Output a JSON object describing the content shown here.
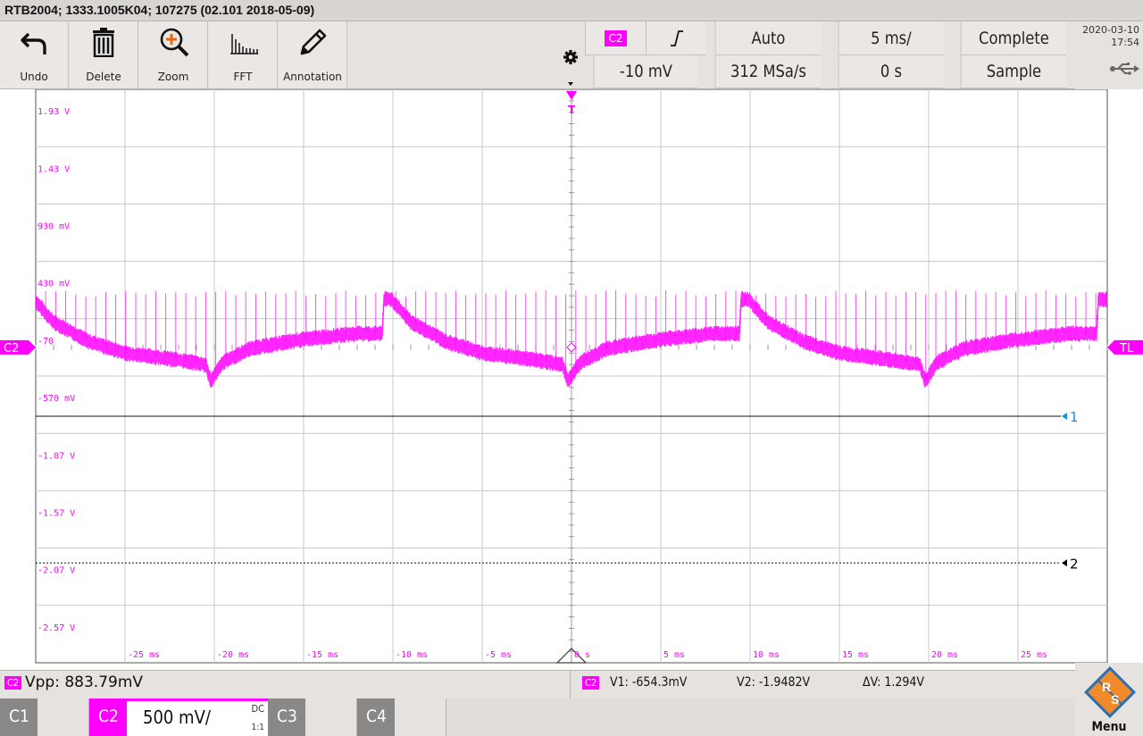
{
  "window": {
    "title": "RTB2004; 1333.1005K04; 107275 (02.101 2018-05-09)"
  },
  "toolbar": {
    "tools": [
      {
        "label": "Undo",
        "icon": "undo-icon"
      },
      {
        "label": "Delete",
        "icon": "trash-icon"
      },
      {
        "label": "Zoom",
        "icon": "zoom-icon"
      },
      {
        "label": "FFT",
        "icon": "fft-icon"
      },
      {
        "label": "Annotation",
        "icon": "pencil-icon"
      }
    ]
  },
  "trigger": {
    "source": "C2",
    "slope_symbol": "╯",
    "mode": "Auto",
    "timebase": "5 ms/",
    "acq_state": "Complete",
    "level": "-10 mV",
    "sample_rate": "312 MSa/s",
    "position": "0 s",
    "acq_mode": "Sample"
  },
  "datetime": {
    "date": "2020-03-10",
    "time": "17:54"
  },
  "chart_data": {
    "type": "line",
    "title": "",
    "xlabel": "",
    "ylabel": "",
    "x_ticks": [
      "-25 ms",
      "-20 ms",
      "-15 ms",
      "-10 ms",
      "-5 ms",
      "0 s",
      "5 ms",
      "10 ms",
      "15 ms",
      "20 ms",
      "25 ms"
    ],
    "x_tick_values_ms": [
      -25,
      -20,
      -15,
      -10,
      -5,
      0,
      5,
      10,
      15,
      20,
      25
    ],
    "y_ticks": [
      "1.93 V",
      "1.43 V",
      "930 mV",
      "430 mV",
      "-70",
      "-570 mV",
      "-1.07 V",
      "-1.57 V",
      "-2.07 V",
      "-2.57 V"
    ],
    "y_tick_values_v": [
      1.93,
      1.43,
      0.93,
      0.43,
      -0.07,
      -0.57,
      -1.07,
      -1.57,
      -2.07,
      -2.57
    ],
    "xlim_ms": [
      -30,
      30
    ],
    "ylim_v": [
      -2.82,
      2.18
    ],
    "grid": true,
    "series": [
      {
        "name": "C2",
        "color": "#ff00ff",
        "period_ms": 20,
        "spike_spacing_ms": 0.56,
        "baseline_v": [
          [
            -30,
            0.33
          ],
          [
            -29,
            0.15
          ],
          [
            -27,
            -0.02
          ],
          [
            -25,
            -0.12
          ],
          [
            -22,
            -0.18
          ],
          [
            -20.5,
            -0.22
          ],
          [
            -20.2,
            -0.36
          ],
          [
            -19.5,
            -0.2
          ],
          [
            -18,
            -0.08
          ],
          [
            -15,
            0.0
          ],
          [
            -12,
            0.05
          ],
          [
            -10.6,
            0.05
          ],
          [
            -10.5,
            0.35
          ]
        ],
        "spike_peak_v": 0.43
      }
    ],
    "markers": [
      {
        "label": "C2",
        "side": "left",
        "value_v": -0.07,
        "color": "#ff00ff"
      },
      {
        "label": "TL",
        "side": "right",
        "value_v": -0.07,
        "color": "#ff00ff"
      },
      {
        "label": "1",
        "value_v": -0.67,
        "color": "#1a8fd8",
        "style": "solid"
      },
      {
        "label": "2",
        "value_v": -1.95,
        "color": "#000000",
        "style": "dotted"
      },
      {
        "label": "T",
        "value_ms": 0,
        "color": "#ff00ff"
      }
    ]
  },
  "measurements": {
    "channel": "C2",
    "vpp": "Vpp: 883.79mV",
    "cursor_channel": "C2",
    "v1": "V1: -654.3mV",
    "v2": "V2: -1.9482V",
    "dv": "ΔV: 1.294V"
  },
  "channels": [
    {
      "label": "C1",
      "active": false
    },
    {
      "label": "C2",
      "active": true,
      "scale": "500 mV/",
      "coupling": "DC",
      "probe": "1:1"
    },
    {
      "label": "C3",
      "active": false
    },
    {
      "label": "C4",
      "active": false
    }
  ],
  "menu": {
    "label": "Menu",
    "logo": "R&S"
  },
  "colors": {
    "accent": "#ff00ff",
    "grid": "#c8c8c8",
    "cursor1": "#1a8fd8"
  }
}
